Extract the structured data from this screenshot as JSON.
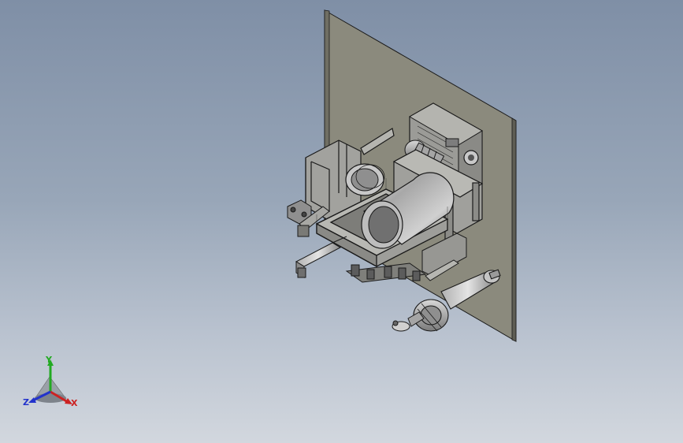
{
  "view": {
    "background_top": "#7f8fa6",
    "background_bottom": "#d2d7de"
  },
  "model": {
    "plate_color": "#8b8a7d",
    "part_color": "#9a9a96",
    "edge_color": "#1a1a1a"
  },
  "triad": {
    "y_label": "Y",
    "z_label": "Z",
    "x_label": "X",
    "y_color": "#22aa22",
    "z_color": "#2233cc",
    "x_color": "#cc2222"
  }
}
